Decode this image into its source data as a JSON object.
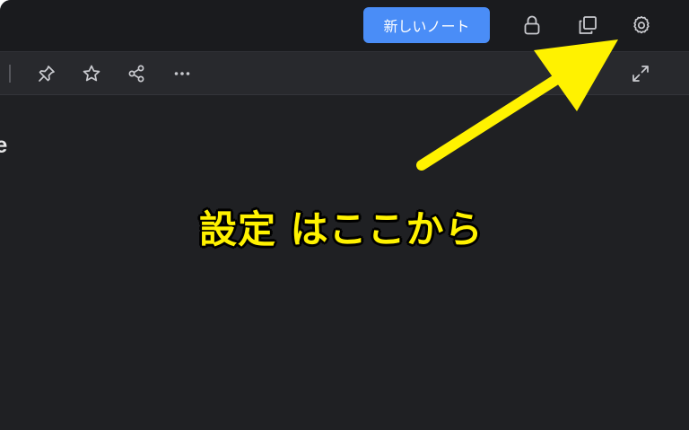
{
  "topbar": {
    "new_note_label": "新しいノート",
    "icons": [
      "lock-icon",
      "duplicate-icon",
      "gear-icon"
    ]
  },
  "toolbar": {
    "icons": [
      "pin-icon",
      "star-icon",
      "share-icon",
      "more-icon",
      "expand-icon"
    ]
  },
  "note": {
    "title_fragment": "te"
  },
  "annotation": {
    "callout_text": "設定 はここから",
    "arrow_color": "#fff200"
  },
  "colors": {
    "accent": "#4a8df7",
    "background": "#1f2023",
    "toolbar": "#28292d"
  }
}
